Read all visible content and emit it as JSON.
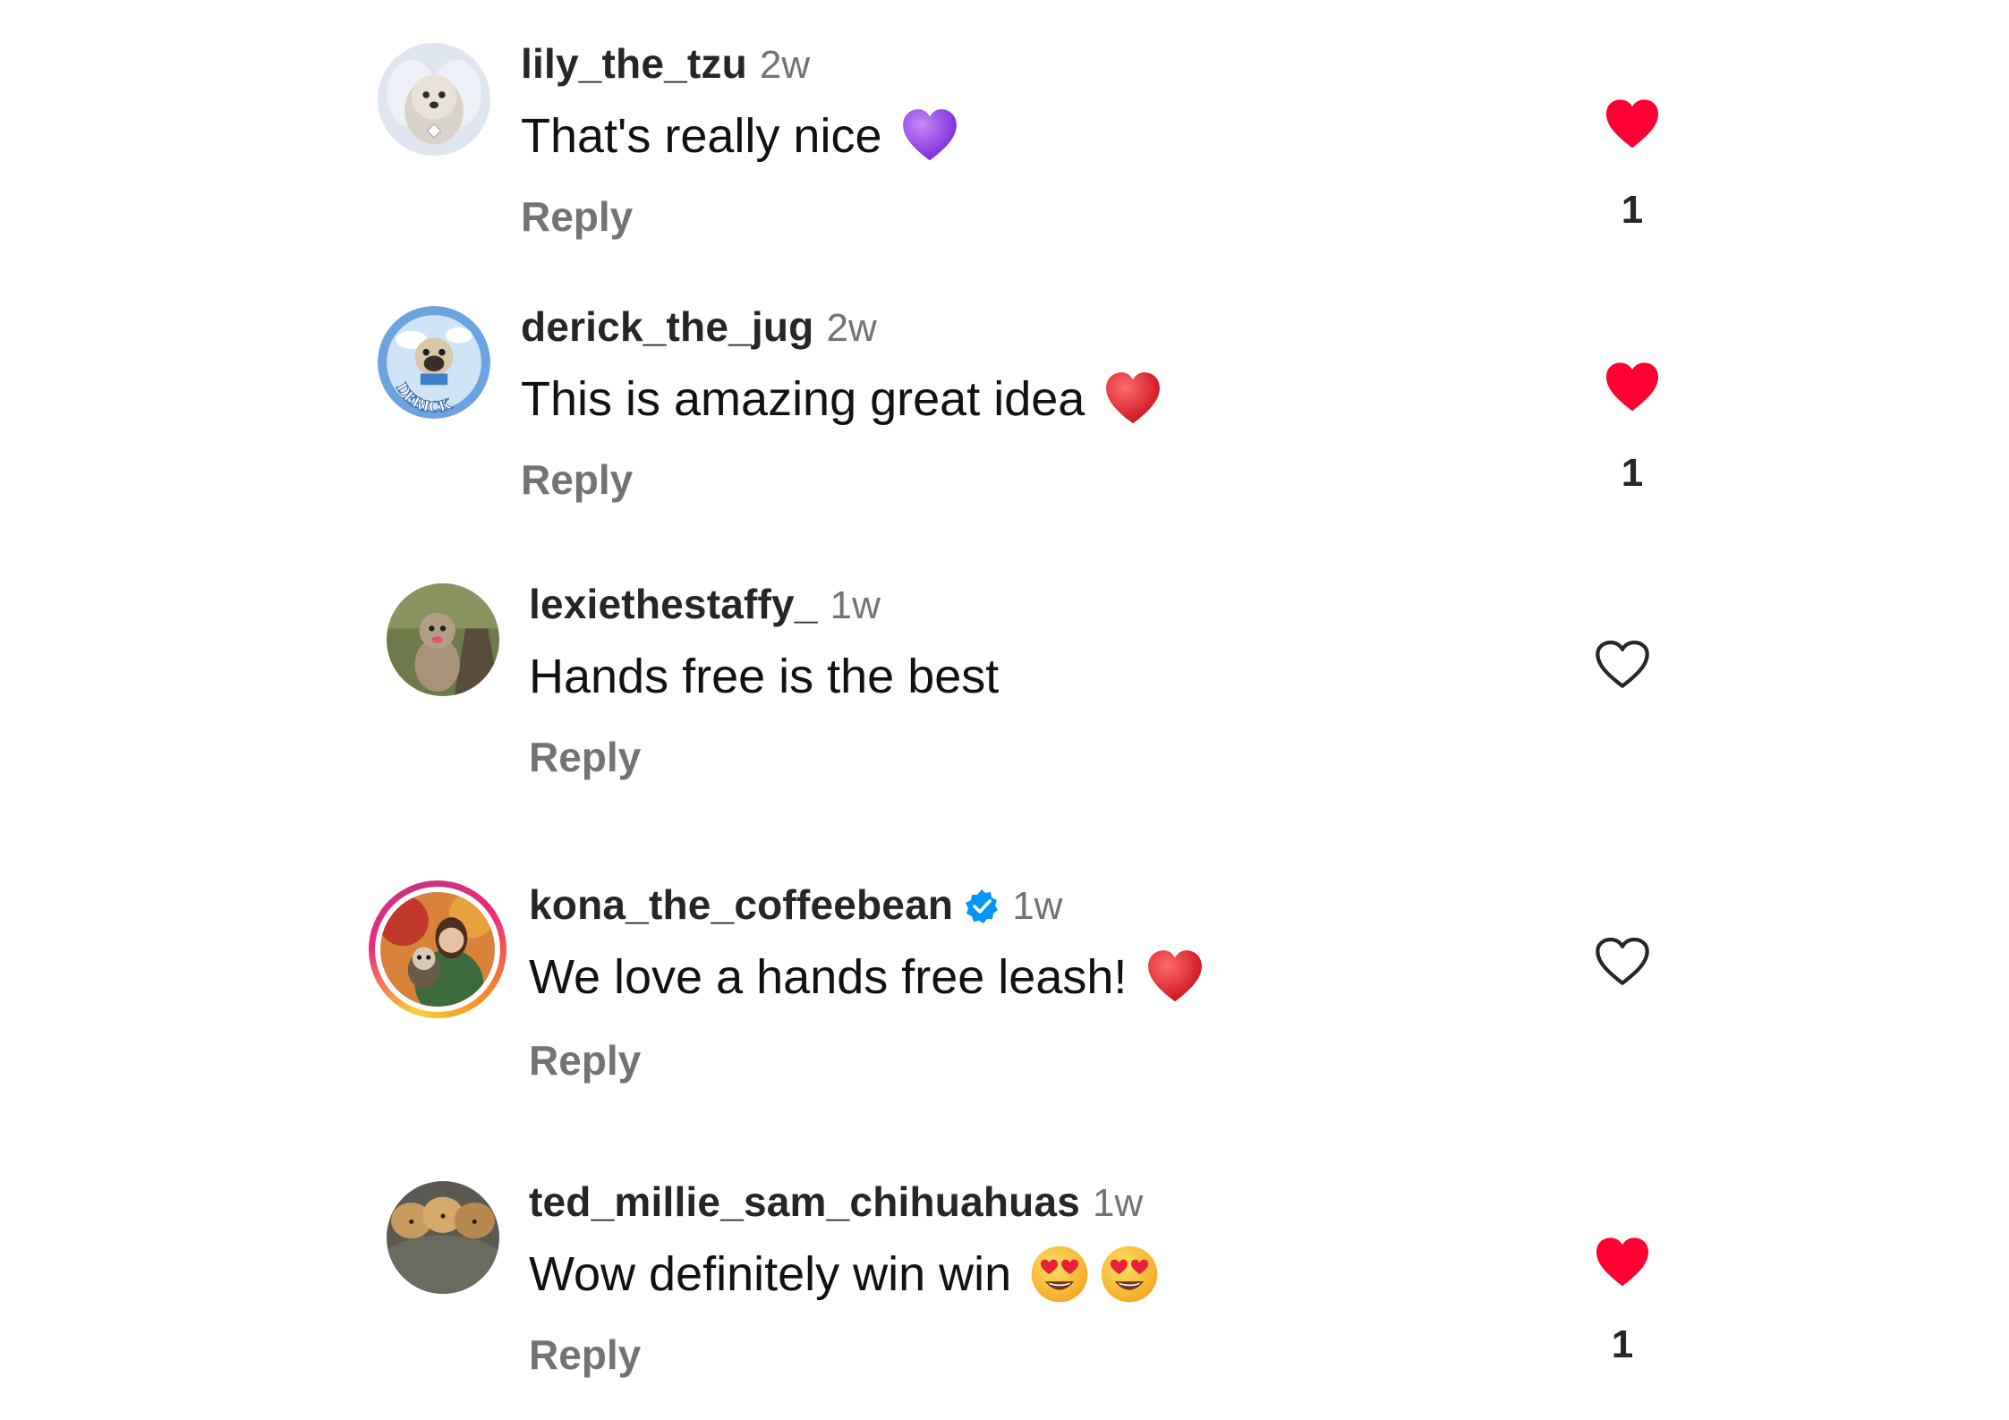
{
  "colors": {
    "liked_heart": "#ff0033",
    "unliked_heart": "#262626",
    "secondary_text": "#737373",
    "verified_badge": "#0095f6"
  },
  "comments": [
    {
      "username": "lily_the_tzu",
      "time": "2w",
      "text": "That's really nice",
      "emojis": [
        "purple-heart-emoji"
      ],
      "reply_label": "Reply",
      "liked": true,
      "like_icon": "heart-filled-icon",
      "like_count": "1",
      "verified": false
    },
    {
      "username": "derick_the_jug",
      "time": "2w",
      "text": "This is amazing great idea",
      "emojis": [
        "red-heart-emoji"
      ],
      "reply_label": "Reply",
      "liked": true,
      "like_icon": "heart-filled-icon",
      "like_count": "1",
      "verified": false,
      "avatar_text": "DERICK"
    },
    {
      "username": "lexiethestaffy_",
      "time": "1w",
      "text": "Hands free is the best",
      "emojis": [],
      "reply_label": "Reply",
      "liked": false,
      "like_icon": "heart-outline-icon",
      "like_count": "",
      "verified": false
    },
    {
      "username": "kona_the_coffeebean",
      "time": "1w",
      "text": "We love a hands free leash!",
      "emojis": [
        "red-heart-emoji"
      ],
      "reply_label": "Reply",
      "liked": false,
      "like_icon": "heart-outline-icon",
      "like_count": "",
      "verified": true,
      "has_story": true
    },
    {
      "username": "ted_millie_sam_chihuahuas",
      "time": "1w",
      "text": "Wow definitely win win",
      "emojis": [
        "heart-eyes-emoji",
        "heart-eyes-emoji"
      ],
      "reply_label": "Reply",
      "liked": true,
      "like_icon": "heart-filled-icon",
      "like_count": "1",
      "verified": false
    }
  ]
}
